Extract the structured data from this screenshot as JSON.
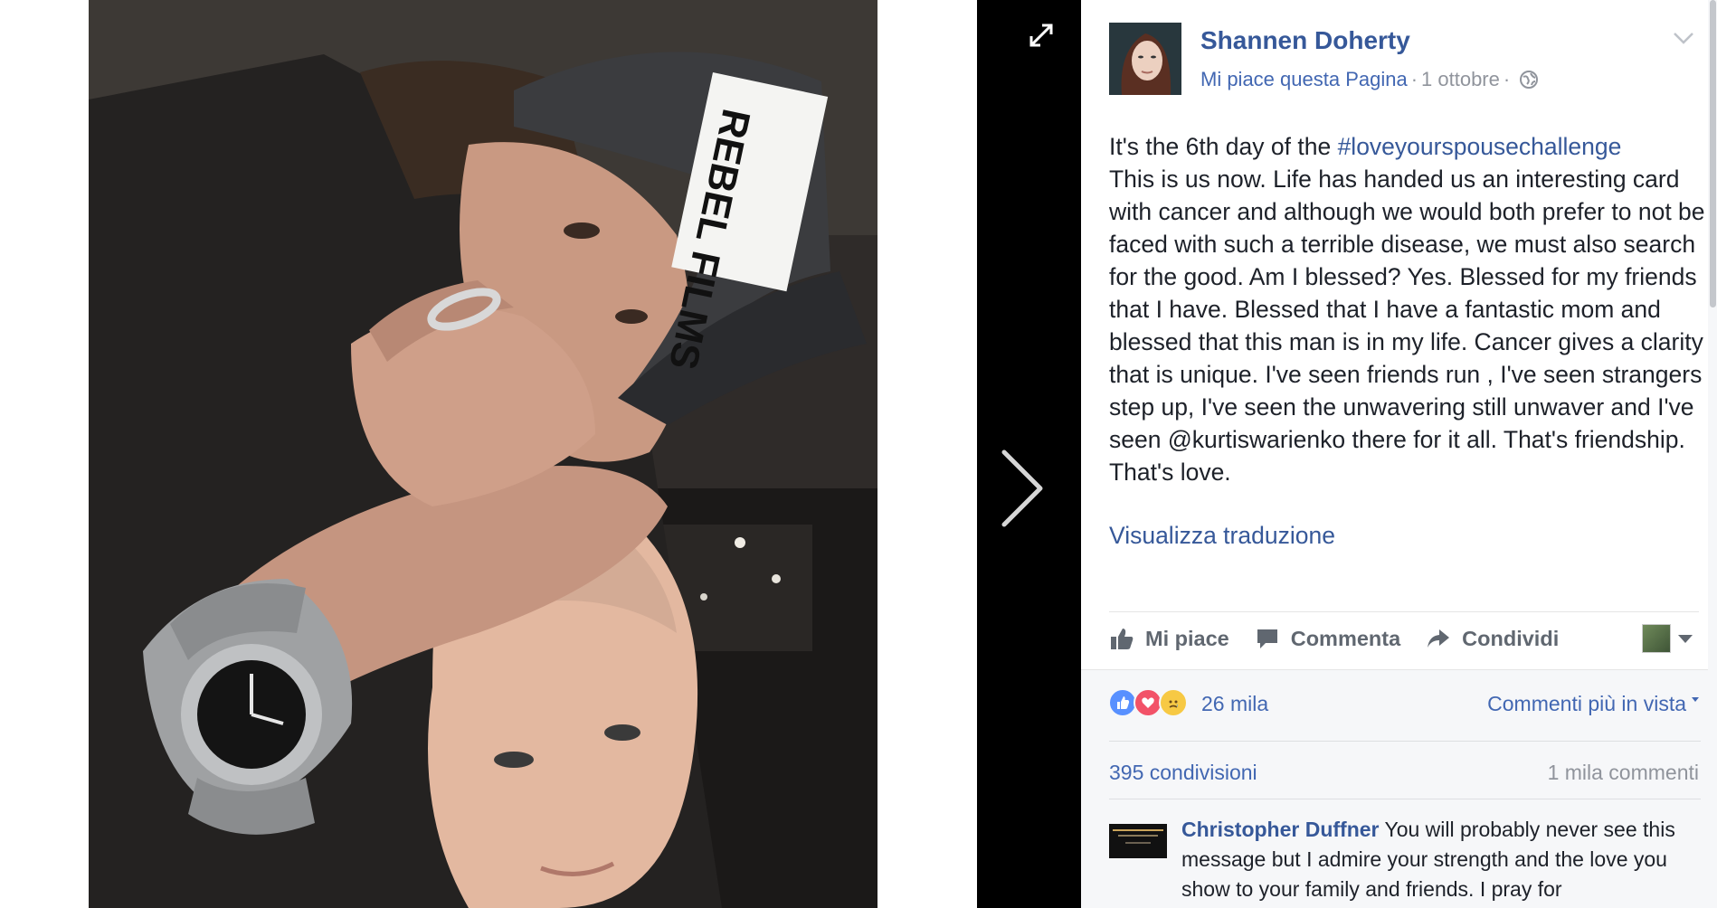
{
  "post": {
    "author": "Shannen Doherty",
    "like_page": "Mi piace questa Pagina",
    "date": "1 ottobre",
    "text_intro": "It's the 6th day of the ",
    "hashtag": "#loveyourspousechallenge",
    "text_body": "This is us now. Life has handed us an interesting card with cancer and although we would both prefer to not be faced with such a terrible disease, we must also search for the good. Am I blessed? Yes. Blessed for my friends that I have. Blessed that I have a fantastic mom and blessed that this man is in my life. Cancer gives a clarity that is unique. I've seen friends run , I've seen strangers step up, I've seen the unwavering still unwaver and I've seen @kurtiswarienko there for it all. That's friendship. That's love.",
    "translate": "Visualizza traduzione"
  },
  "photo": {
    "cap_text": "REBEL FILMS"
  },
  "actions": {
    "like": "Mi piace",
    "comment": "Commenta",
    "share": "Condividi"
  },
  "stats": {
    "reactions": "26 mila",
    "top_comments": "Commenti più in vista",
    "shares": "395 condivisioni",
    "comments": "1 mila commenti"
  },
  "comment": {
    "author": "Christopher Duffner",
    "text": "You will probably never see this message but I admire your strength and the love you show to your family and friends. I pray for"
  },
  "colors": {
    "link": "#365899",
    "accent": "#4267b2",
    "text": "#1d2129",
    "muted": "#90949c"
  }
}
